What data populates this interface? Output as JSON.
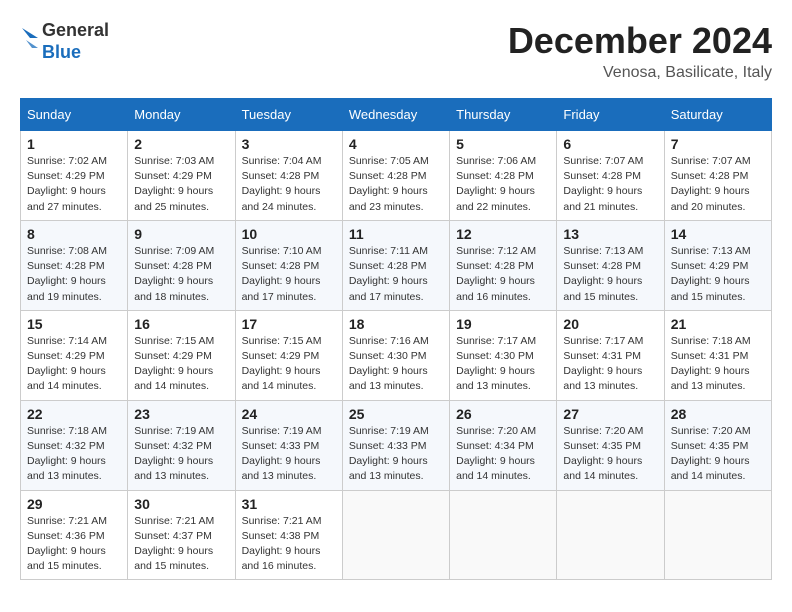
{
  "logo": {
    "line1": "General",
    "line2": "Blue"
  },
  "header": {
    "month": "December 2024",
    "location": "Venosa, Basilicate, Italy"
  },
  "weekdays": [
    "Sunday",
    "Monday",
    "Tuesday",
    "Wednesday",
    "Thursday",
    "Friday",
    "Saturday"
  ],
  "weeks": [
    [
      {
        "day": "1",
        "sunrise": "7:02 AM",
        "sunset": "4:29 PM",
        "daylight": "9 hours and 27 minutes."
      },
      {
        "day": "2",
        "sunrise": "7:03 AM",
        "sunset": "4:29 PM",
        "daylight": "9 hours and 25 minutes."
      },
      {
        "day": "3",
        "sunrise": "7:04 AM",
        "sunset": "4:28 PM",
        "daylight": "9 hours and 24 minutes."
      },
      {
        "day": "4",
        "sunrise": "7:05 AM",
        "sunset": "4:28 PM",
        "daylight": "9 hours and 23 minutes."
      },
      {
        "day": "5",
        "sunrise": "7:06 AM",
        "sunset": "4:28 PM",
        "daylight": "9 hours and 22 minutes."
      },
      {
        "day": "6",
        "sunrise": "7:07 AM",
        "sunset": "4:28 PM",
        "daylight": "9 hours and 21 minutes."
      },
      {
        "day": "7",
        "sunrise": "7:07 AM",
        "sunset": "4:28 PM",
        "daylight": "9 hours and 20 minutes."
      }
    ],
    [
      {
        "day": "8",
        "sunrise": "7:08 AM",
        "sunset": "4:28 PM",
        "daylight": "9 hours and 19 minutes."
      },
      {
        "day": "9",
        "sunrise": "7:09 AM",
        "sunset": "4:28 PM",
        "daylight": "9 hours and 18 minutes."
      },
      {
        "day": "10",
        "sunrise": "7:10 AM",
        "sunset": "4:28 PM",
        "daylight": "9 hours and 17 minutes."
      },
      {
        "day": "11",
        "sunrise": "7:11 AM",
        "sunset": "4:28 PM",
        "daylight": "9 hours and 17 minutes."
      },
      {
        "day": "12",
        "sunrise": "7:12 AM",
        "sunset": "4:28 PM",
        "daylight": "9 hours and 16 minutes."
      },
      {
        "day": "13",
        "sunrise": "7:13 AM",
        "sunset": "4:28 PM",
        "daylight": "9 hours and 15 minutes."
      },
      {
        "day": "14",
        "sunrise": "7:13 AM",
        "sunset": "4:29 PM",
        "daylight": "9 hours and 15 minutes."
      }
    ],
    [
      {
        "day": "15",
        "sunrise": "7:14 AM",
        "sunset": "4:29 PM",
        "daylight": "9 hours and 14 minutes."
      },
      {
        "day": "16",
        "sunrise": "7:15 AM",
        "sunset": "4:29 PM",
        "daylight": "9 hours and 14 minutes."
      },
      {
        "day": "17",
        "sunrise": "7:15 AM",
        "sunset": "4:29 PM",
        "daylight": "9 hours and 14 minutes."
      },
      {
        "day": "18",
        "sunrise": "7:16 AM",
        "sunset": "4:30 PM",
        "daylight": "9 hours and 13 minutes."
      },
      {
        "day": "19",
        "sunrise": "7:17 AM",
        "sunset": "4:30 PM",
        "daylight": "9 hours and 13 minutes."
      },
      {
        "day": "20",
        "sunrise": "7:17 AM",
        "sunset": "4:31 PM",
        "daylight": "9 hours and 13 minutes."
      },
      {
        "day": "21",
        "sunrise": "7:18 AM",
        "sunset": "4:31 PM",
        "daylight": "9 hours and 13 minutes."
      }
    ],
    [
      {
        "day": "22",
        "sunrise": "7:18 AM",
        "sunset": "4:32 PM",
        "daylight": "9 hours and 13 minutes."
      },
      {
        "day": "23",
        "sunrise": "7:19 AM",
        "sunset": "4:32 PM",
        "daylight": "9 hours and 13 minutes."
      },
      {
        "day": "24",
        "sunrise": "7:19 AM",
        "sunset": "4:33 PM",
        "daylight": "9 hours and 13 minutes."
      },
      {
        "day": "25",
        "sunrise": "7:19 AM",
        "sunset": "4:33 PM",
        "daylight": "9 hours and 13 minutes."
      },
      {
        "day": "26",
        "sunrise": "7:20 AM",
        "sunset": "4:34 PM",
        "daylight": "9 hours and 14 minutes."
      },
      {
        "day": "27",
        "sunrise": "7:20 AM",
        "sunset": "4:35 PM",
        "daylight": "9 hours and 14 minutes."
      },
      {
        "day": "28",
        "sunrise": "7:20 AM",
        "sunset": "4:35 PM",
        "daylight": "9 hours and 14 minutes."
      }
    ],
    [
      {
        "day": "29",
        "sunrise": "7:21 AM",
        "sunset": "4:36 PM",
        "daylight": "9 hours and 15 minutes."
      },
      {
        "day": "30",
        "sunrise": "7:21 AM",
        "sunset": "4:37 PM",
        "daylight": "9 hours and 15 minutes."
      },
      {
        "day": "31",
        "sunrise": "7:21 AM",
        "sunset": "4:38 PM",
        "daylight": "9 hours and 16 minutes."
      },
      null,
      null,
      null,
      null
    ]
  ],
  "labels": {
    "sunrise": "Sunrise:",
    "sunset": "Sunset:",
    "daylight": "Daylight:"
  }
}
